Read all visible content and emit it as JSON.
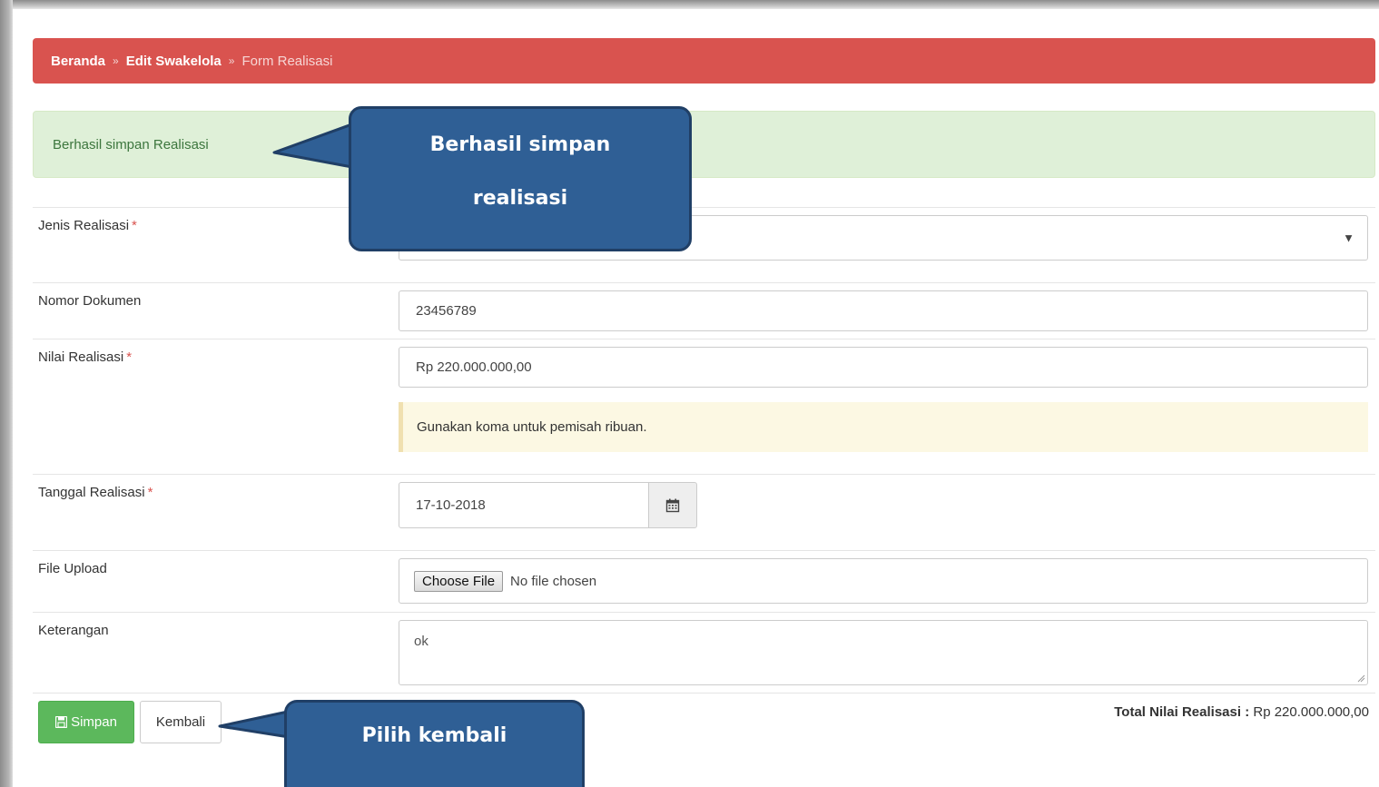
{
  "breadcrumb": {
    "home": "Beranda",
    "edit": "Edit Swakelola",
    "current": "Form Realisasi",
    "separator": "»"
  },
  "alert": {
    "message": "Berhasil simpan Realisasi"
  },
  "form": {
    "jenis_label": "Jenis Realisasi",
    "jenis_value": "",
    "nomor_label": "Nomor Dokumen",
    "nomor_value": "23456789",
    "nilai_label": "Nilai Realisasi",
    "nilai_value": "Rp 220.000.000,00",
    "nilai_note": "Gunakan koma untuk pemisah ribuan.",
    "tanggal_label": "Tanggal Realisasi",
    "tanggal_value": "17-10-2018",
    "file_label": "File Upload",
    "file_button": "Choose File",
    "file_status": "No file chosen",
    "keterangan_label": "Keterangan",
    "keterangan_value": "ok",
    "required_mark": "*"
  },
  "actions": {
    "simpan": "Simpan",
    "kembali": "Kembali"
  },
  "total": {
    "label": "Total Nilai Realisasi :",
    "value": "Rp 220.000.000,00"
  },
  "callouts": {
    "top_line1": "Berhasil simpan",
    "top_line2": "realisasi",
    "bottom": "Pilih kembali"
  },
  "colors": {
    "breadcrumb_bg": "#d9534f",
    "alert_bg": "#dff0d8",
    "note_bg": "#fcf8e3",
    "simpan_bg": "#5cb85c",
    "callout_bg": "#2f5f95"
  }
}
